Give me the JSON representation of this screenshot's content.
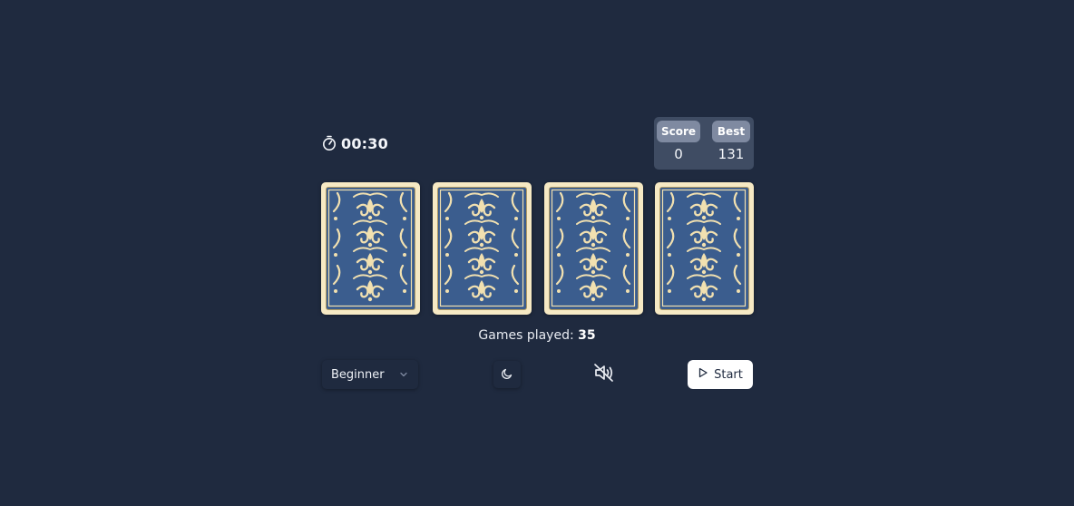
{
  "timer": {
    "value": "00:30",
    "icon": "stopwatch-icon"
  },
  "scoreboard": {
    "score_label": "Score",
    "score_value": "0",
    "best_label": "Best",
    "best_value": "131"
  },
  "cards": [
    {
      "face": "down"
    },
    {
      "face": "down"
    },
    {
      "face": "down"
    },
    {
      "face": "down"
    }
  ],
  "stats": {
    "games_played_label": "Games played:",
    "games_played_value": "35"
  },
  "controls": {
    "difficulty": "Beginner",
    "theme_icon": "moon-icon",
    "sound_icon": "volume-muted-icon",
    "start_label": "Start",
    "start_icon": "play-icon"
  },
  "colors": {
    "background": "#1f2a3f",
    "card_border": "#f6e9c4",
    "card_back": "#3b5d8e",
    "card_ornament": "#f1e0b0",
    "score_panel": "#3f4c63",
    "score_pill": "#7f8aa1"
  }
}
